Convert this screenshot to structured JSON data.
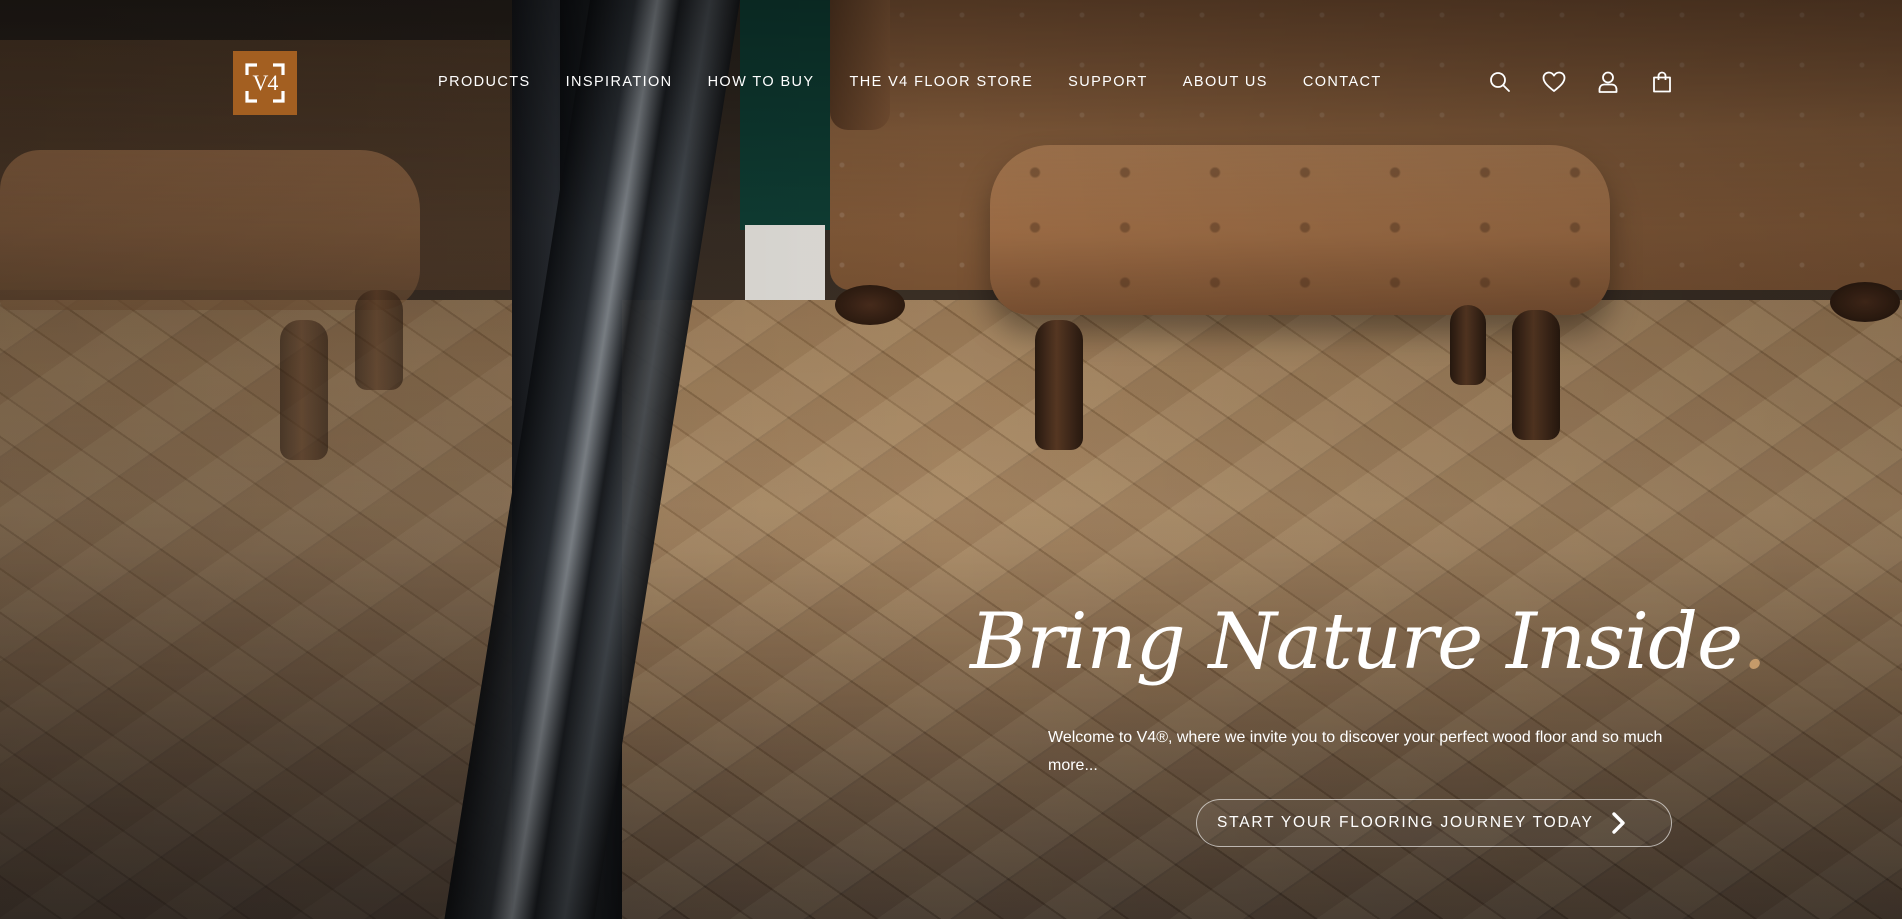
{
  "brand": {
    "logo_text": "V4",
    "logo_color": "#a35f21"
  },
  "nav": {
    "items": [
      {
        "label": "PRODUCTS"
      },
      {
        "label": "INSPIRATION"
      },
      {
        "label": "HOW TO BUY"
      },
      {
        "label": "THE V4 FLOOR STORE"
      },
      {
        "label": "SUPPORT"
      },
      {
        "label": "ABOUT US"
      },
      {
        "label": "CONTACT"
      }
    ]
  },
  "header_icons": [
    {
      "name": "search-icon"
    },
    {
      "name": "heart-icon"
    },
    {
      "name": "user-icon"
    },
    {
      "name": "shopping-bag-icon"
    }
  ],
  "hero": {
    "headline": "Bring Nature Inside",
    "headline_dot": ".",
    "accent_color": "#c59a6a",
    "subtitle": "Welcome to V4®, where we invite you to discover your perfect wood floor and so much more...",
    "cta_label": "START YOUR FLOORING JOURNEY TODAY",
    "cta_icon": "chevron-right-icon"
  }
}
